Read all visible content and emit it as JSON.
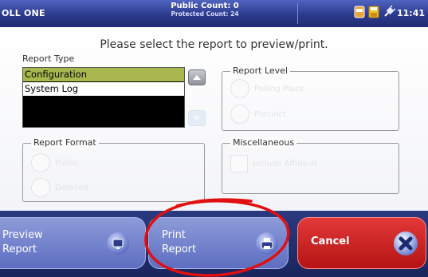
{
  "header": {
    "title": "OLL ONE",
    "public_count": "Public Count: 0",
    "protected_count": "Protected Count: 24",
    "time": "11:41 AM",
    "icons": [
      "card-icon",
      "disk-icon",
      "power-plug-icon"
    ]
  },
  "instruction": "Please select the report to preview/print.",
  "report_type": {
    "label": "Report Type",
    "items": [
      "Configuration",
      "System Log"
    ],
    "selected": "Configuration"
  },
  "report_level": {
    "label": "Report Level",
    "options": [
      "Polling Place",
      "Precinct"
    ]
  },
  "report_format": {
    "label": "Report Format",
    "options": [
      "Public",
      "Detailed"
    ]
  },
  "miscellaneous": {
    "label": "Miscellaneous",
    "options": [
      "Include Affidavit"
    ]
  },
  "buttons": {
    "preview": [
      "Preview",
      "Report"
    ],
    "print": [
      "Print",
      "Report"
    ],
    "cancel": "Cancel"
  },
  "colors": {
    "header_blue": "#2c3a8c",
    "selection": "#a8b84f",
    "cancel_red": "#d12727",
    "annotation_red": "#e01010"
  }
}
